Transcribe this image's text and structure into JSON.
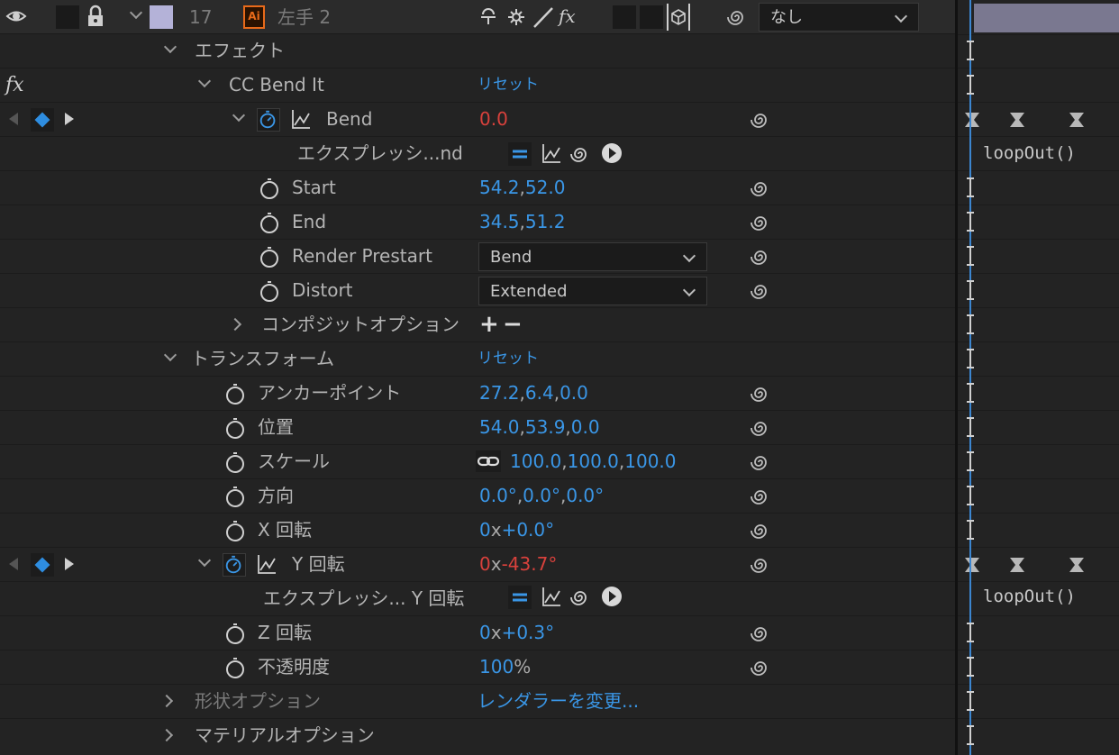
{
  "layer": {
    "number": "17",
    "name": "左手 2",
    "file_badge": "Ai",
    "parent_value": "なし",
    "fx_label": "fx"
  },
  "groups": {
    "effects": "エフェクト",
    "transform": "トランスフォーム",
    "transform_reset": "リセット",
    "geometry_options": "形状オプション",
    "change_renderer": "レンダラーを変更...",
    "material_options": "マテリアルオプション"
  },
  "effect": {
    "fx_badge": "fx",
    "name": "CC Bend It",
    "reset": "リセット",
    "properties": {
      "bend": {
        "label": "Bend",
        "value": "0.0"
      },
      "bend_expression": {
        "label": "エクスプレッシ...nd",
        "code": "loopOut()"
      },
      "start": {
        "label": "Start",
        "x": "54.2",
        "y": "52.0"
      },
      "end": {
        "label": "End",
        "x": "34.5",
        "y": "51.2"
      },
      "render_prestart": {
        "label": "Render Prestart",
        "value": "Bend"
      },
      "distort": {
        "label": "Distort",
        "value": "Extended"
      },
      "composite": {
        "label": "コンポジットオプション",
        "plus": "+",
        "minus": "−"
      }
    }
  },
  "transform": {
    "anchor": {
      "label": "アンカーポイント",
      "x": "27.2",
      "y": "6.4",
      "z": "0.0"
    },
    "position": {
      "label": "位置",
      "x": "54.0",
      "y": "53.9",
      "z": "0.0"
    },
    "scale": {
      "label": "スケール",
      "x": "100.0",
      "y": "100.0",
      "z": "100.0"
    },
    "orientation": {
      "label": "方向",
      "x": "0.0°",
      "y": "0.0°",
      "z": "0.0°"
    },
    "x_rotation": {
      "label": "X 回転",
      "rev": "0",
      "x": "x",
      "deg": "+0.0°"
    },
    "y_rotation": {
      "label": "Y 回転",
      "rev": "0",
      "x": "x",
      "deg": "-43.7°"
    },
    "y_rotation_expression": {
      "label": "エクスプレッシ... Y 回転",
      "code": "loopOut()"
    },
    "z_rotation": {
      "label": "Z 回転",
      "rev": "0",
      "x": "x",
      "deg": "+0.3°"
    },
    "opacity": {
      "label": "不透明度",
      "value": "100",
      "unit": "%"
    }
  },
  "separators": {
    "comma": ","
  },
  "colors": {
    "accent_blue": "#3a96e6",
    "keyframed_red": "#d8413c",
    "label_swatch": "#b4b2d8",
    "playhead": "#3c86d0"
  }
}
